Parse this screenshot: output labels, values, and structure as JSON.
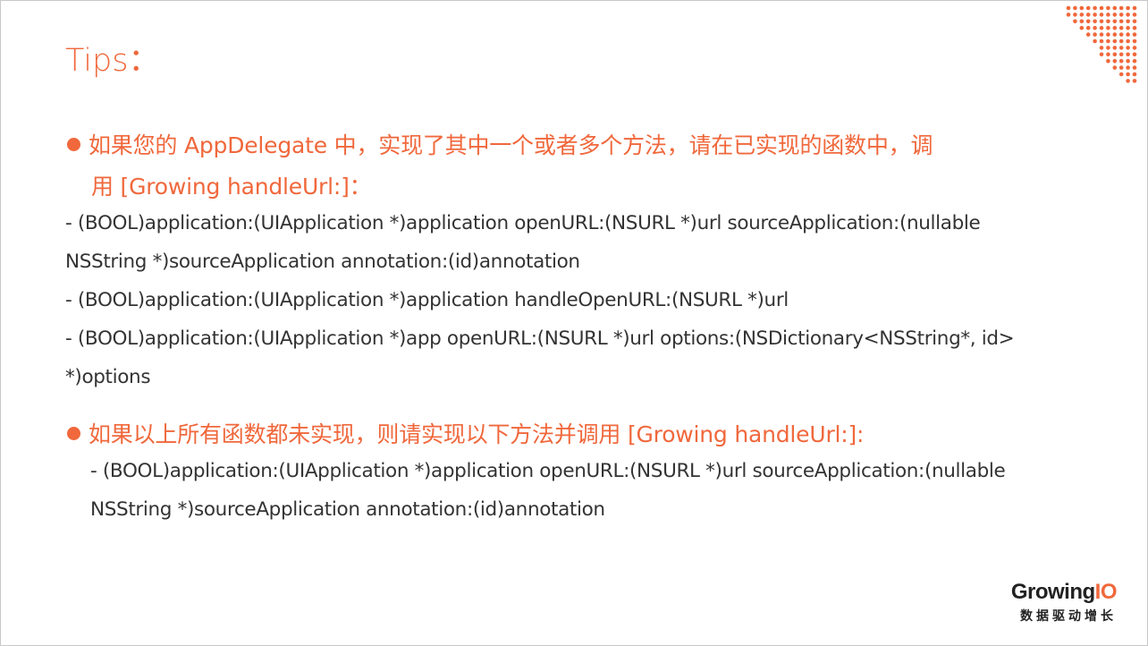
{
  "slide": {
    "title": "Tips：",
    "bullets": [
      {
        "lines": [
          "如果您的 AppDelegate 中，实现了其中一个或者多个方法，请在已实现的函数中，调",
          "用 [Growing handleUrl:]："
        ],
        "code": [
          " - (BOOL)application:(UIApplication *)application openURL:(NSURL *)url sourceApplication:(nullable",
          "NSString *)sourceApplication annotation:(id)annotation",
          " - (BOOL)application:(UIApplication *)application handleOpenURL:(NSURL *)url",
          " - (BOOL)application:(UIApplication *)app openURL:(NSURL *)url options:(NSDictionary<NSString*, id>",
          "*)options"
        ]
      },
      {
        "lines": [
          "如果以上所有函数都未实现，则请实现以下方法并调用 [Growing handleUrl:]:"
        ],
        "code": [
          " - (BOOL)application:(UIApplication *)application openURL:(NSURL *)url sourceApplication:(nullable",
          "NSString *)sourceApplication annotation:(id)annotation"
        ]
      }
    ]
  },
  "logo": {
    "brand_main": "Growing",
    "brand_accent": "IO",
    "tagline": "数据驱动增长"
  },
  "colors": {
    "accent": "#f0683c",
    "body_text": "#333333",
    "logo_text": "#222222"
  },
  "icons": {
    "decoration": "dot-grid-decoration",
    "bullet": "bullet-dot"
  }
}
